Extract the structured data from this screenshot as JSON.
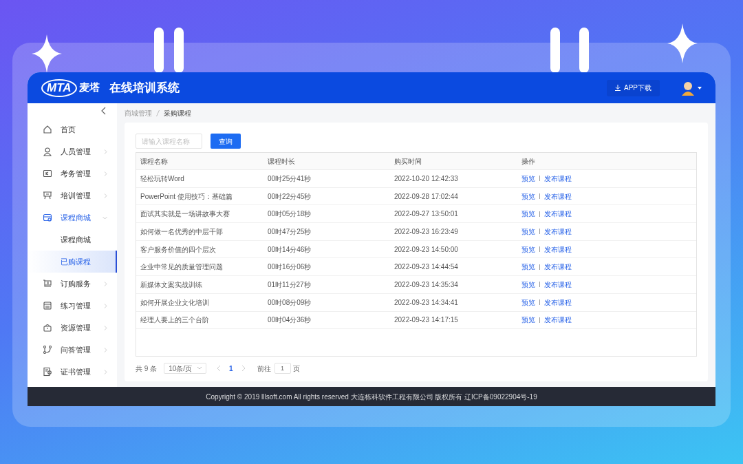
{
  "header": {
    "logo_mark": "MTA",
    "logo_name": "麦塔",
    "title": "在线培训系统",
    "download_button": "APP下载"
  },
  "sidebar": {
    "items": [
      {
        "label": "首页",
        "kind": "link",
        "selected": false
      },
      {
        "label": "人员管理",
        "kind": "group",
        "selected": false,
        "expanded": false
      },
      {
        "label": "考务管理",
        "kind": "group",
        "selected": false,
        "expanded": false
      },
      {
        "label": "培训管理",
        "kind": "group",
        "selected": false,
        "expanded": false
      },
      {
        "label": "课程商城",
        "kind": "group",
        "selected": true,
        "expanded": true,
        "children": [
          {
            "label": "课程商城",
            "selected": false
          },
          {
            "label": "已购课程",
            "selected": true
          }
        ]
      },
      {
        "label": "订购服务",
        "kind": "group",
        "selected": false,
        "expanded": false
      },
      {
        "label": "练习管理",
        "kind": "group",
        "selected": false,
        "expanded": false
      },
      {
        "label": "资源管理",
        "kind": "group",
        "selected": false,
        "expanded": false
      },
      {
        "label": "问答管理",
        "kind": "group",
        "selected": false,
        "expanded": false
      },
      {
        "label": "证书管理",
        "kind": "group",
        "selected": false,
        "expanded": false
      }
    ]
  },
  "breadcrumb": [
    "商城管理",
    "采购课程"
  ],
  "search": {
    "placeholder": "请输入课程名称",
    "button": "查询"
  },
  "table": {
    "columns": [
      "课程名称",
      "课程时长",
      "购买时间",
      "操作"
    ],
    "rows": [
      {
        "name": "轻松玩转Word",
        "duration": "00时25分41秒",
        "purchased": "2022-10-20 12:42:33",
        "actions": [
          "预览",
          "发布课程"
        ]
      },
      {
        "name": "PowerPoint 使用技巧：基础篇",
        "duration": "00时22分45秒",
        "purchased": "2022-09-28 17:02:44",
        "actions": [
          "预览",
          "发布课程"
        ]
      },
      {
        "name": "面试其实就是一场讲故事大赛",
        "duration": "00时05分18秒",
        "purchased": "2022-09-27 13:50:01",
        "actions": [
          "预览",
          "发布课程"
        ]
      },
      {
        "name": "如何做一名优秀的中层干部",
        "duration": "00时47分25秒",
        "purchased": "2022-09-23 16:23:49",
        "actions": [
          "预览",
          "发布课程"
        ]
      },
      {
        "name": "客户服务价值的四个层次",
        "duration": "00时14分46秒",
        "purchased": "2022-09-23 14:50:00",
        "actions": [
          "预览",
          "发布课程"
        ]
      },
      {
        "name": "企业中常见的质量管理问题",
        "duration": "00时16分06秒",
        "purchased": "2022-09-23 14:44:54",
        "actions": [
          "预览",
          "发布课程"
        ]
      },
      {
        "name": "新媒体文案实战训练",
        "duration": "01时11分27秒",
        "purchased": "2022-09-23 14:35:34",
        "actions": [
          "预览",
          "发布课程"
        ]
      },
      {
        "name": "如何开展企业文化培训",
        "duration": "00时08分09秒",
        "purchased": "2022-09-23 14:34:41",
        "actions": [
          "预览",
          "发布课程"
        ]
      },
      {
        "name": "经理人要上的三个台阶",
        "duration": "00时04分36秒",
        "purchased": "2022-09-23 14:17:15",
        "actions": [
          "预览",
          "发布课程"
        ]
      }
    ]
  },
  "pagination": {
    "total": "共 9 条",
    "page_size": "10条/页",
    "pages": [
      {
        "label": "1",
        "selected": true
      }
    ],
    "goto_label": "前往",
    "goto_value": "1",
    "goto_suffix": "页"
  },
  "footer": "Copyright © 2019 lllsoft.com All rights reserved 大连栋科软件工程有限公司 版权所有 辽ICP备09022904号-19"
}
